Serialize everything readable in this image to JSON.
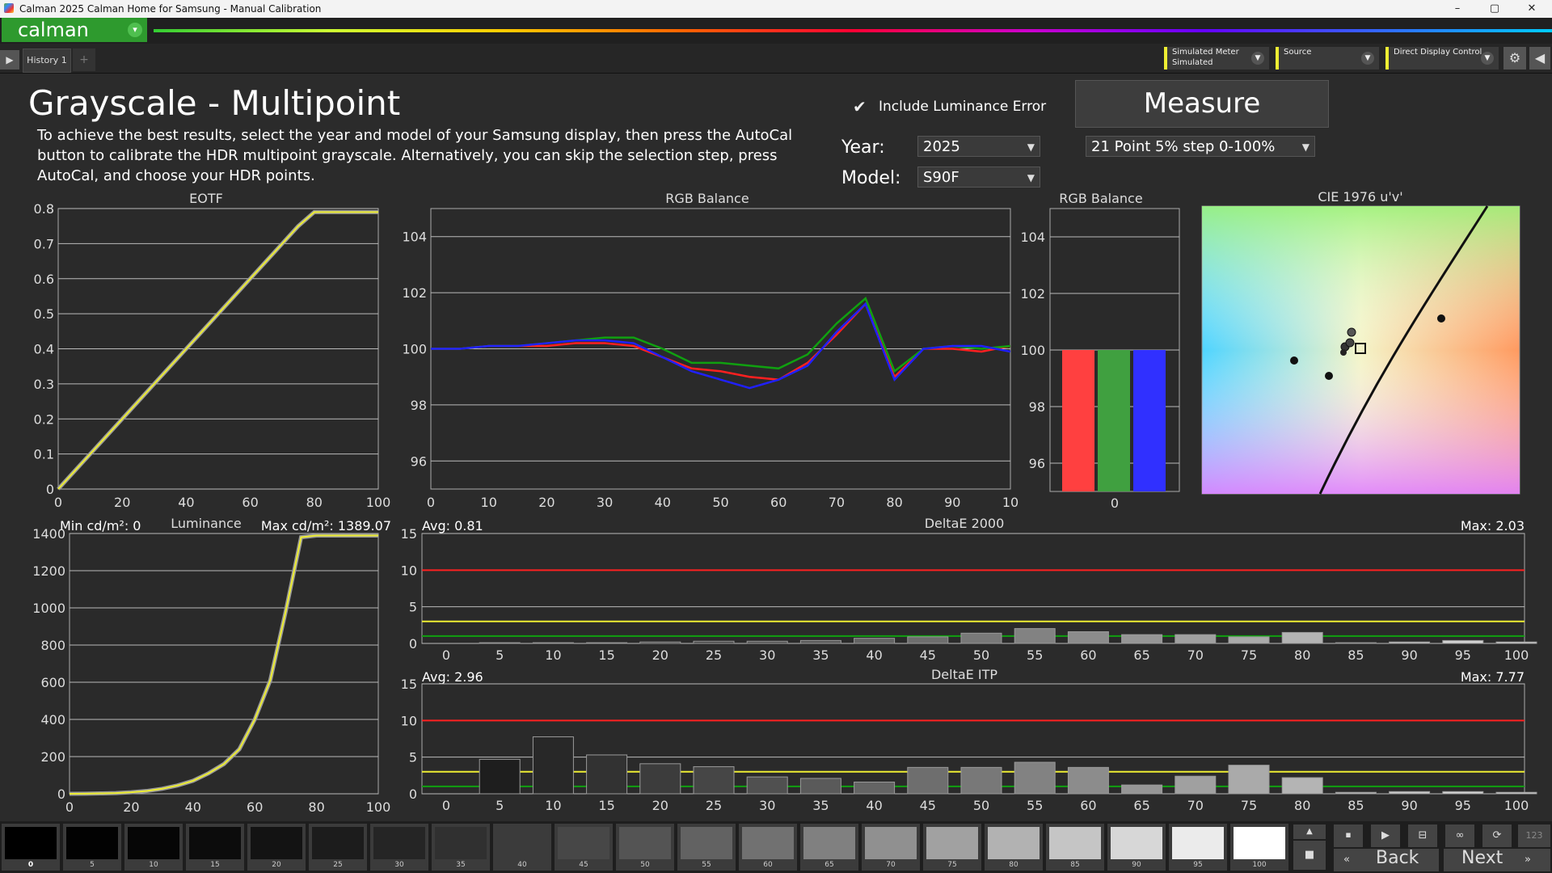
{
  "window": {
    "title": "Calman 2025 Calman Home for Samsung  - Manual Calibration",
    "min": "–",
    "max": "▢",
    "close": "✕"
  },
  "brand": {
    "logo": "calman",
    "dropdown": "▾"
  },
  "tabs": {
    "nav": "▶",
    "history": "History 1",
    "add": "+"
  },
  "devices": [
    {
      "line1": "Simulated Meter",
      "line2": "Simulated"
    },
    {
      "line1": "Source",
      "line2": ""
    },
    {
      "line1": "Direct Display Control",
      "line2": ""
    }
  ],
  "page": {
    "title": "Grayscale - Multipoint",
    "description": "To achieve the best results, select the year and model of your Samsung display, then press the AutoCal button to calibrate the HDR multipoint grayscale. Alternatively, you can skip the selection step, press AutoCal, and choose your HDR points.",
    "include_luminance_error": "Include Luminance Error",
    "include_luminance_checked": true,
    "measure": "Measure",
    "year_label": "Year:",
    "year_value": "2025",
    "model_label": "Model:",
    "model_value": "S90F",
    "points_value": "21 Point 5% step 0-100%"
  },
  "colors": {
    "accent_green": "#2e9a2e",
    "meter_yellow": "#eeee33",
    "red": "#ff2020",
    "green": "#10a010",
    "blue": "#2020ff"
  },
  "chart_data": [
    {
      "type": "line",
      "title": "EOTF",
      "x": [
        0,
        5,
        10,
        15,
        20,
        25,
        30,
        35,
        40,
        45,
        50,
        55,
        60,
        65,
        70,
        75,
        80,
        85,
        90,
        95,
        100
      ],
      "series": [
        {
          "values": [
            0,
            0.05,
            0.1,
            0.15,
            0.2,
            0.25,
            0.3,
            0.35,
            0.4,
            0.45,
            0.5,
            0.55,
            0.6,
            0.65,
            0.7,
            0.75,
            0.79,
            0.79,
            0.79,
            0.79,
            0.79
          ]
        }
      ],
      "xlim": [
        0,
        100
      ],
      "ylim": [
        0,
        0.8
      ],
      "xticks": [
        0,
        20,
        40,
        60,
        80,
        100
      ],
      "yticks": [
        "0",
        "0.1",
        "0.2",
        "0.3",
        "0.4",
        "0.5",
        "0.6",
        "0.7",
        "0.8"
      ]
    },
    {
      "type": "line",
      "title": "RGB Balance",
      "x": [
        0,
        5,
        10,
        15,
        20,
        25,
        30,
        35,
        40,
        45,
        50,
        55,
        60,
        65,
        70,
        75,
        80,
        85,
        90,
        95,
        100
      ],
      "series": [
        {
          "color": "#ff2020",
          "values": [
            100,
            100,
            100.1,
            100.1,
            100.1,
            100.2,
            100.2,
            100.1,
            99.7,
            99.3,
            99.2,
            99,
            98.9,
            99.5,
            100.5,
            101.6,
            99,
            100,
            100,
            99.9,
            100.1
          ]
        },
        {
          "color": "#10a010",
          "values": [
            100,
            100,
            100.1,
            100.1,
            100.2,
            100.3,
            100.4,
            100.4,
            100,
            99.5,
            99.5,
            99.4,
            99.3,
            99.8,
            100.9,
            101.8,
            99.2,
            100,
            100.1,
            100,
            100.1
          ]
        },
        {
          "color": "#2020ff",
          "values": [
            100,
            100,
            100.1,
            100.1,
            100.2,
            100.3,
            100.3,
            100.2,
            99.7,
            99.2,
            98.9,
            98.6,
            98.9,
            99.4,
            100.6,
            101.6,
            98.9,
            100,
            100.1,
            100.1,
            99.9
          ]
        }
      ],
      "xlim": [
        0,
        100
      ],
      "ylim": [
        95,
        105
      ],
      "xticks": [
        "0",
        "10",
        "20",
        "30",
        "40",
        "50",
        "60",
        "70",
        "80",
        "90",
        "10"
      ],
      "yticks": [
        "96",
        "98",
        "100",
        "102",
        "104"
      ]
    },
    {
      "type": "bar",
      "title": "RGB Balance",
      "categories": [
        "0"
      ],
      "series": [
        {
          "color": "#ff4040",
          "values": [
            100
          ]
        },
        {
          "color": "#40a040",
          "values": [
            100
          ]
        },
        {
          "color": "#3030ff",
          "values": [
            100
          ]
        }
      ],
      "ylim": [
        95,
        105
      ],
      "yticks": [
        "96",
        "98",
        "100",
        "102",
        "104"
      ]
    },
    {
      "type": "scatter",
      "title": "CIE 1976 u'v'"
    },
    {
      "type": "line",
      "title": "Luminance",
      "min_label": "Min cd/m²: 0",
      "max_label": "Max cd/m²: 1389.07",
      "x": [
        0,
        5,
        10,
        15,
        20,
        25,
        30,
        35,
        40,
        45,
        50,
        55,
        60,
        65,
        70,
        75,
        80,
        85,
        90,
        95,
        100
      ],
      "series": [
        {
          "values": [
            0,
            0.5,
            2,
            4,
            8,
            15,
            27,
            45,
            70,
            110,
            160,
            240,
            400,
            610,
            980,
            1380,
            1389,
            1389,
            1389,
            1389,
            1389
          ]
        }
      ],
      "xlim": [
        0,
        100
      ],
      "ylim": [
        0,
        1400
      ],
      "xticks": [
        0,
        20,
        40,
        60,
        80,
        100
      ],
      "yticks": [
        "0",
        "200",
        "400",
        "600",
        "800",
        "1000",
        "1200",
        "1400"
      ]
    },
    {
      "type": "bar",
      "title": "DeltaE 2000",
      "avg_label": "Avg: 0.81",
      "max_label": "Max: 2.03",
      "categories": [
        "0",
        "5",
        "10",
        "15",
        "20",
        "25",
        "30",
        "35",
        "40",
        "45",
        "50",
        "55",
        "60",
        "65",
        "70",
        "75",
        "80",
        "85",
        "90",
        "95",
        "100"
      ],
      "values": [
        0,
        0.1,
        0.1,
        0.1,
        0.2,
        0.3,
        0.3,
        0.4,
        0.7,
        0.9,
        1.4,
        2.03,
        1.6,
        1.2,
        1.2,
        0.9,
        1.5,
        0.1,
        0.2,
        0.4,
        0.2
      ],
      "ylim": [
        0,
        15
      ],
      "yticks": [
        "0",
        "5",
        "10",
        "15"
      ],
      "threshold_lines": [
        10,
        3,
        1
      ]
    },
    {
      "type": "bar",
      "title": "DeltaE ITP",
      "avg_label": "Avg: 2.96",
      "max_label": "Max: 7.77",
      "categories": [
        "0",
        "5",
        "10",
        "15",
        "20",
        "25",
        "30",
        "35",
        "40",
        "45",
        "50",
        "55",
        "60",
        "65",
        "70",
        "75",
        "80",
        "85",
        "90",
        "95",
        "100"
      ],
      "values": [
        0,
        4.7,
        7.77,
        5.3,
        4.1,
        3.7,
        2.3,
        2.1,
        1.6,
        3.6,
        3.6,
        4.3,
        3.6,
        1.2,
        2.4,
        3.9,
        2.2,
        0.2,
        0.3,
        0.3,
        0.2
      ],
      "ylim": [
        0,
        15
      ],
      "yticks": [
        "0",
        "5",
        "10",
        "15"
      ],
      "threshold_lines": [
        10,
        3,
        1
      ]
    }
  ],
  "patches": {
    "labels": [
      "0",
      "5",
      "10",
      "15",
      "20",
      "25",
      "30",
      "35",
      "40",
      "45",
      "50",
      "55",
      "60",
      "65",
      "70",
      "75",
      "80",
      "85",
      "90",
      "95",
      "100"
    ]
  },
  "controls": {
    "back": "Back",
    "next": "Next",
    "counter": "123"
  }
}
